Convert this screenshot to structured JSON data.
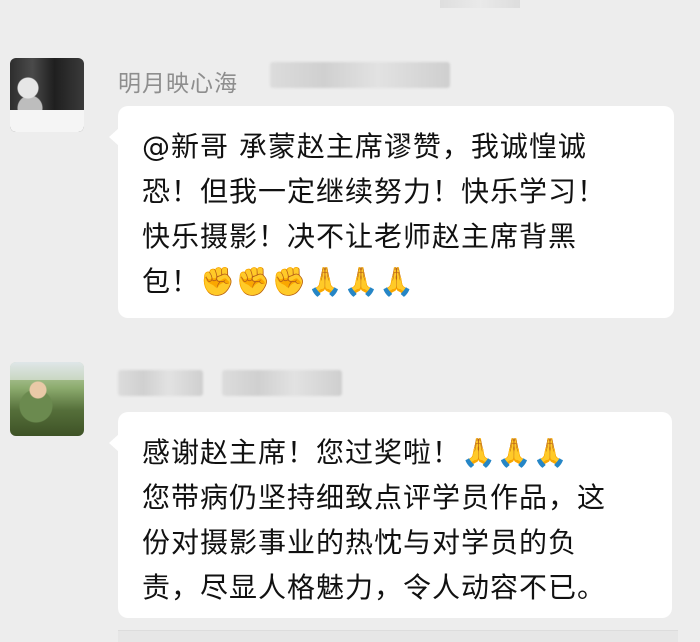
{
  "messages": [
    {
      "sender": "明月映心海",
      "lines": [
        "@新哥 承蒙赵主席谬赞，我诚惶诚",
        "恐！但我一定继续努力！快乐学习！",
        "快乐摄影！决不让老师赵主席背黑",
        "包！✊✊✊🙏🙏🙏"
      ]
    },
    {
      "sender": "",
      "lines": [
        "感谢赵主席！您过奖啦！🙏🙏🙏",
        "您带病仍坚持细致点评学员作品，这",
        "份对摄影事业的热忱与对学员的负",
        "责，尽显人格魅力，令人动容不已。"
      ]
    }
  ],
  "colors": {
    "background": "#ededed",
    "bubble": "#ffffff",
    "sender_name": "#8e8e8e",
    "text": "#111111"
  },
  "icons": [
    "avatar-photo-monochrome",
    "avatar-photo-garden"
  ]
}
